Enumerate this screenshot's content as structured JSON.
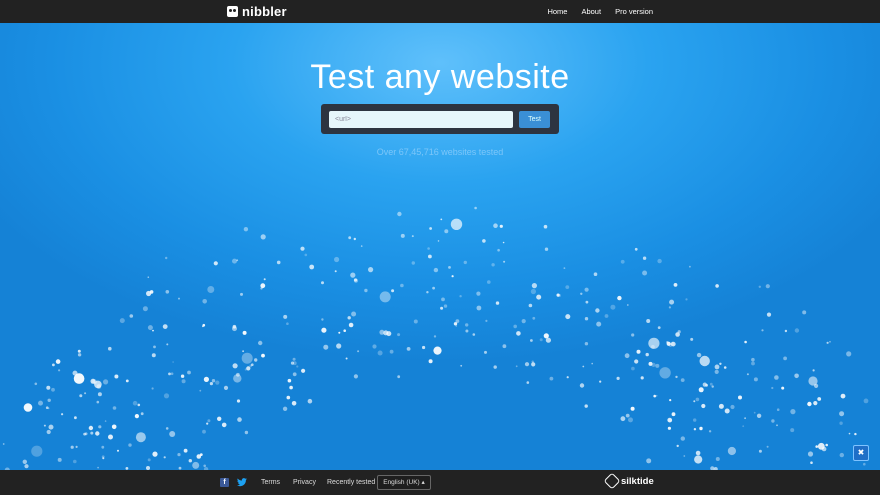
{
  "header": {
    "logo_text": "nibbler",
    "nav": [
      "Home",
      "About",
      "Pro version"
    ]
  },
  "hero": {
    "title": "Test any website",
    "search": {
      "value": "<url>",
      "button_label": "Test"
    },
    "tested_text": "Over 67,45,716 websites tested"
  },
  "footer": {
    "links": [
      "Terms",
      "Privacy",
      "Recently tested"
    ],
    "language": "English (UK) ▴",
    "brand": "silktide"
  },
  "colors": {
    "bar": "#222222",
    "hero": "#1a8fe3",
    "accent": "#3a8fd6"
  }
}
